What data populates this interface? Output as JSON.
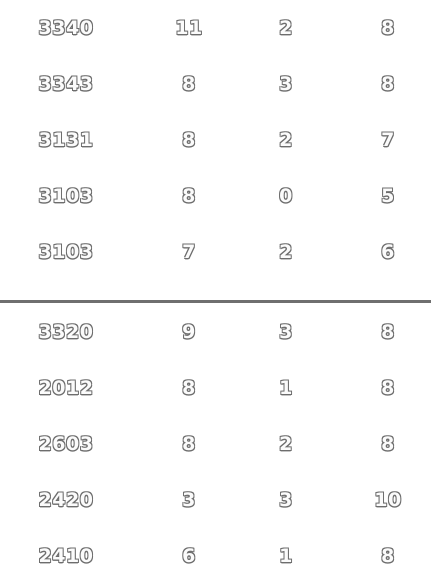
{
  "table": {
    "group_top": [
      [
        "3340",
        "11",
        "2",
        "8"
      ],
      [
        "3343",
        "8",
        "3",
        "8"
      ],
      [
        "3131",
        "8",
        "2",
        "7"
      ],
      [
        "3103",
        "8",
        "0",
        "5"
      ],
      [
        "3103",
        "7",
        "2",
        "6"
      ]
    ],
    "group_bottom": [
      [
        "3320",
        "9",
        "3",
        "8"
      ],
      [
        "2012",
        "8",
        "1",
        "8"
      ],
      [
        "2603",
        "8",
        "2",
        "8"
      ],
      [
        "2420",
        "3",
        "3",
        "10"
      ],
      [
        "2410",
        "6",
        "1",
        "8"
      ]
    ]
  },
  "colors": {
    "text_fill": "#fbfbfb",
    "text_outline": "#6d6d6d",
    "divider": "#6f6f6f"
  }
}
